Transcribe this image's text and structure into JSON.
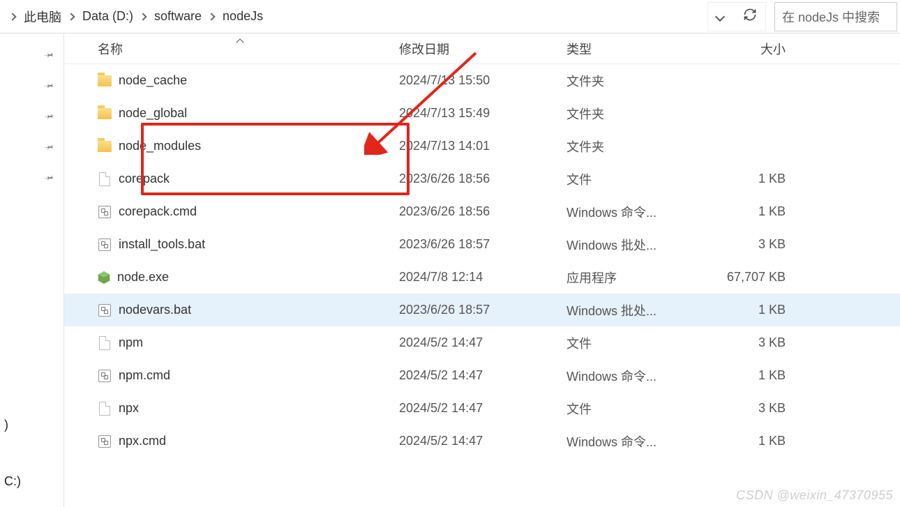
{
  "breadcrumb": {
    "items": [
      "此电脑",
      "Data (D:)",
      "software",
      "nodeJs"
    ]
  },
  "search": {
    "placeholder": "在 nodeJs 中搜索"
  },
  "columns": {
    "name": "名称",
    "date": "修改日期",
    "type": "类型",
    "size": "大小"
  },
  "left_pinned_count": 5,
  "left_labels": {
    "a": ")",
    "b": "C:)"
  },
  "files": [
    {
      "icon": "folder",
      "name": "node_cache",
      "date": "2024/7/13 15:50",
      "type": "文件夹",
      "size": ""
    },
    {
      "icon": "folder",
      "name": "node_global",
      "date": "2024/7/13 15:49",
      "type": "文件夹",
      "size": ""
    },
    {
      "icon": "folder",
      "name": "node_modules",
      "date": "2024/7/13 14:01",
      "type": "文件夹",
      "size": ""
    },
    {
      "icon": "file",
      "name": "corepack",
      "date": "2023/6/26 18:56",
      "type": "文件",
      "size": "1 KB"
    },
    {
      "icon": "cmd",
      "name": "corepack.cmd",
      "date": "2023/6/26 18:56",
      "type": "Windows 命令...",
      "size": "1 KB"
    },
    {
      "icon": "cmd",
      "name": "install_tools.bat",
      "date": "2023/6/26 18:57",
      "type": "Windows 批处...",
      "size": "3 KB"
    },
    {
      "icon": "exe",
      "name": "node.exe",
      "date": "2024/7/8 12:14",
      "type": "应用程序",
      "size": "67,707 KB"
    },
    {
      "icon": "cmd",
      "name": "nodevars.bat",
      "date": "2023/6/26 18:57",
      "type": "Windows 批处...",
      "size": "1 KB",
      "selected": true
    },
    {
      "icon": "file",
      "name": "npm",
      "date": "2024/5/2 14:47",
      "type": "文件",
      "size": "3 KB"
    },
    {
      "icon": "cmd",
      "name": "npm.cmd",
      "date": "2024/5/2 14:47",
      "type": "Windows 命令...",
      "size": "1 KB"
    },
    {
      "icon": "file",
      "name": "npx",
      "date": "2024/5/2 14:47",
      "type": "文件",
      "size": "3 KB"
    },
    {
      "icon": "cmd",
      "name": "npx.cmd",
      "date": "2024/5/2 14:47",
      "type": "Windows 命令...",
      "size": "1 KB"
    }
  ],
  "watermark": "CSDN @weixin_47370955"
}
